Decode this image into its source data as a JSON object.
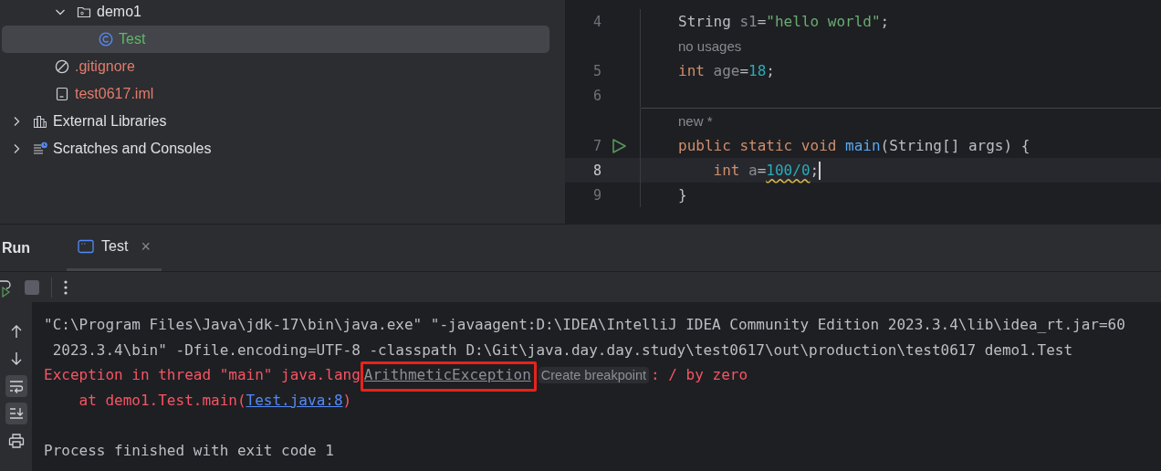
{
  "project_tree": [
    {
      "children": [
        {
          "children": [
            {
              "label": "demo1",
              "kind": "package",
              "color": "#dfe1e5",
              "expanded": true,
              "selected": false,
              "children": [
                {
                  "label": "Test",
                  "kind": "class",
                  "color": "#5fb865",
                  "selected": true
                }
              ]
            }
          ]
        },
        {
          "label": ".gitignore",
          "kind": "ignore",
          "color": "#e27b6d",
          "selected": false
        },
        {
          "label": "test0617.iml",
          "kind": "module",
          "color": "#e27b6d",
          "selected": false
        }
      ]
    },
    {
      "label": "External Libraries",
      "kind": "library",
      "color": "#dfe1e5",
      "expanded": false,
      "selected": false
    },
    {
      "label": "Scratches and Consoles",
      "kind": "scratches",
      "color": "#dfe1e5",
      "expanded": false,
      "selected": false
    }
  ],
  "editor": {
    "rows": [
      {
        "kind": "code",
        "number": "4",
        "current": false,
        "run": false,
        "tokens": [
          {
            "kind": "type",
            "text": "String "
          },
          {
            "kind": "unused",
            "text": "s1"
          },
          {
            "kind": "plain",
            "text": "="
          },
          {
            "kind": "string",
            "text": "\"hello world\""
          },
          {
            "kind": "plain",
            "text": ";"
          }
        ]
      },
      {
        "kind": "hint",
        "text": "no usages"
      },
      {
        "kind": "code",
        "number": "5",
        "current": false,
        "run": false,
        "tokens": [
          {
            "kind": "keyword",
            "text": "int "
          },
          {
            "kind": "unused",
            "text": "age"
          },
          {
            "kind": "plain",
            "text": "="
          },
          {
            "kind": "number",
            "text": "18",
            "warning": false
          },
          {
            "kind": "plain",
            "text": ";"
          }
        ]
      },
      {
        "kind": "code",
        "number": "6",
        "current": false,
        "run": false,
        "tokens": []
      },
      {
        "kind": "separator"
      },
      {
        "kind": "hint",
        "text": "new *"
      },
      {
        "kind": "code",
        "number": "7",
        "current": false,
        "run": true,
        "tokens": [
          {
            "kind": "keyword",
            "text": "public static void "
          },
          {
            "kind": "method",
            "text": "main"
          },
          {
            "kind": "plain",
            "text": "(String[] args) {"
          }
        ]
      },
      {
        "kind": "code",
        "number": "8",
        "current": true,
        "run": false,
        "tokens": [
          {
            "kind": "keyword",
            "text": "    int "
          },
          {
            "kind": "unused",
            "text": "a"
          },
          {
            "kind": "plain",
            "text": "="
          },
          {
            "kind": "number",
            "text": "100/0",
            "warning": true
          },
          {
            "kind": "plain",
            "text": ";"
          }
        ]
      },
      {
        "kind": "code",
        "number": "9",
        "current": false,
        "run": false,
        "tokens": [
          {
            "kind": "plain",
            "text": "}"
          }
        ]
      }
    ]
  },
  "run_panel": {
    "title": "Run",
    "tabs": [
      {
        "label": "Test",
        "close": "×",
        "selected": true
      }
    ],
    "side_tools": [
      {
        "kind": "up",
        "selected": false
      },
      {
        "kind": "down",
        "selected": false
      },
      {
        "kind": "wrap",
        "selected": true
      },
      {
        "kind": "scroll-end",
        "selected": true
      },
      {
        "kind": "print",
        "selected": false
      }
    ],
    "console_lines": [
      {
        "kind": "command",
        "segments": [
          {
            "kind": "text",
            "text": "\"C:\\Program Files\\Java\\jdk-17\\bin\\java.exe\" \"-javaagent:D:\\IDEA\\IntelliJ IDEA Community Edition 2023.3.4\\lib\\idea_rt.jar=60",
            "highlighted": false
          }
        ]
      },
      {
        "kind": "command",
        "segments": [
          {
            "kind": "text",
            "text": " 2023.3.4\\bin\" -Dfile.encoding=UTF-8 -classpath D:\\Git\\java.day.day.study\\test0617\\out\\production\\test0617 demo1.Test",
            "highlighted": false
          }
        ]
      },
      {
        "kind": "error",
        "segments": [
          {
            "kind": "text",
            "text": "Exception in thread \"main\" java.lang",
            "highlighted": false
          },
          {
            "kind": "class-link",
            "text": "ArithmeticException",
            "highlighted": true
          },
          {
            "kind": "badge",
            "text": "Create breakpoint",
            "highlighted": false
          },
          {
            "kind": "text",
            "text": ": / by zero",
            "highlighted": false
          }
        ]
      },
      {
        "kind": "error",
        "segments": [
          {
            "kind": "text",
            "text": "    at demo1.Test.main(",
            "highlighted": false
          },
          {
            "kind": "file-link",
            "text": "Test.java:8",
            "highlighted": false
          },
          {
            "kind": "text",
            "text": ")",
            "highlighted": false
          }
        ]
      },
      {
        "kind": "blank"
      },
      {
        "kind": "command",
        "segments": [
          {
            "kind": "text",
            "text": "Process finished with exit code 1",
            "highlighted": false
          }
        ]
      }
    ]
  }
}
